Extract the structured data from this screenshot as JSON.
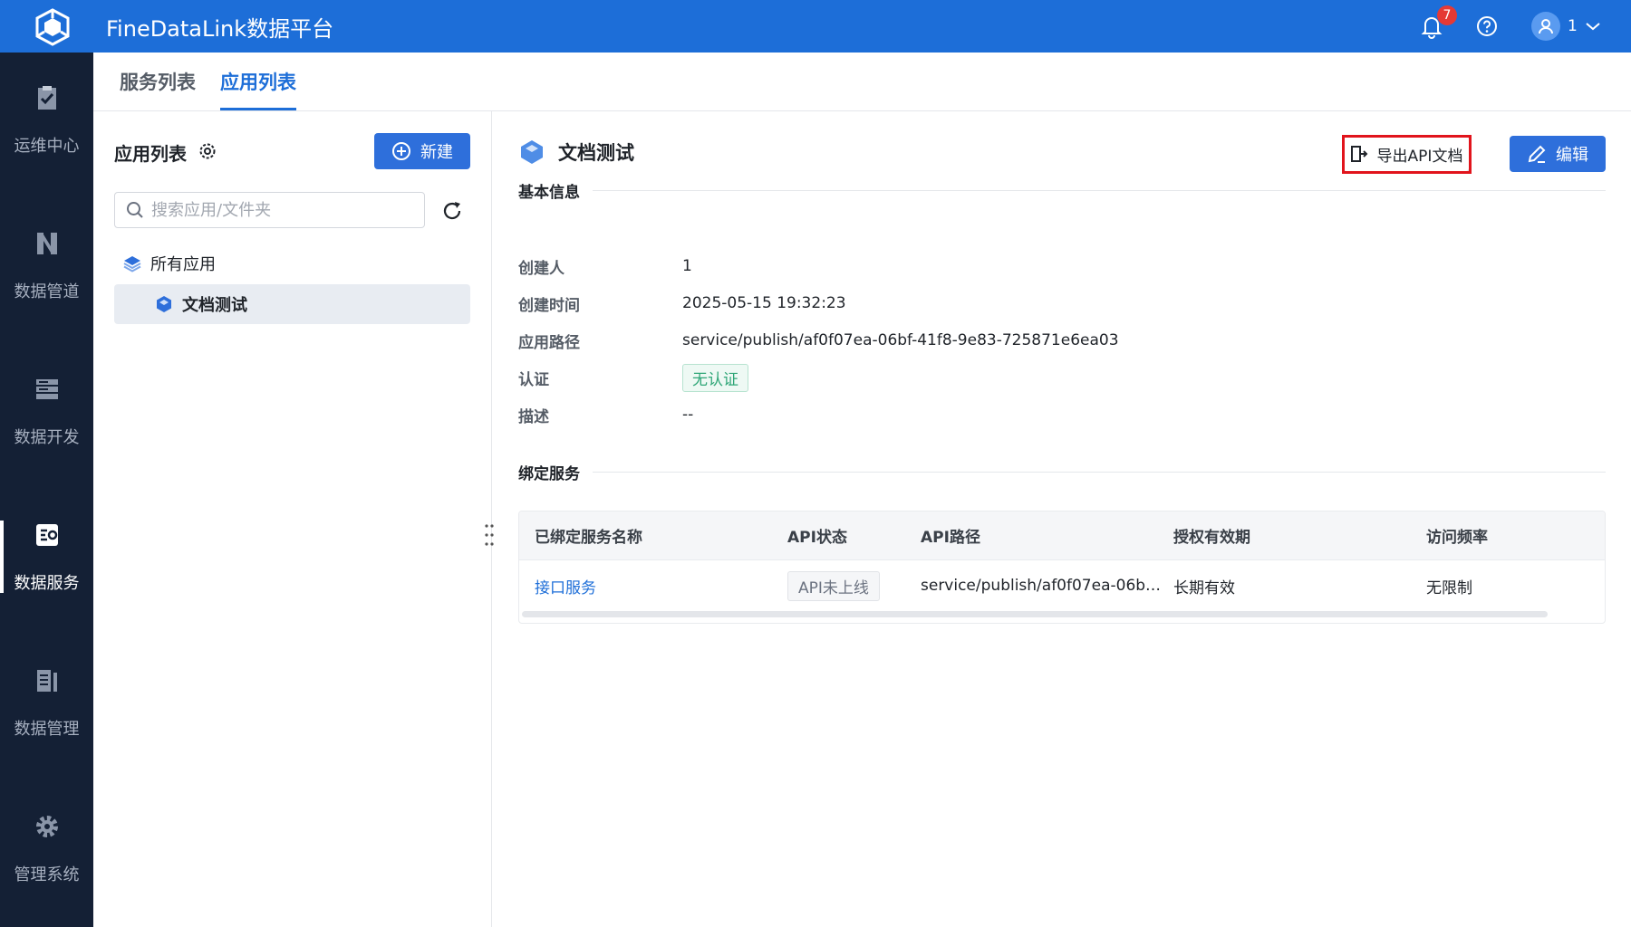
{
  "header": {
    "app_title": "FineDataLink数据平台",
    "notification_count": "7",
    "user_name": "1",
    "brand_color": "#1d6ed8"
  },
  "sidebar": {
    "items": [
      {
        "label": "运维中心",
        "icon": "clipboard-check-icon"
      },
      {
        "label": "数据管道",
        "icon": "pipeline-icon"
      },
      {
        "label": "数据开发",
        "icon": "server-icon"
      },
      {
        "label": "数据服务",
        "icon": "api-service-icon",
        "active": true
      },
      {
        "label": "数据管理",
        "icon": "catalog-icon"
      },
      {
        "label": "管理系统",
        "icon": "gear-icon"
      }
    ]
  },
  "tabs": [
    {
      "label": "服务列表"
    },
    {
      "label": "应用列表",
      "active": true
    }
  ],
  "left_panel": {
    "title": "应用列表",
    "new_button": "新建",
    "search_placeholder": "搜索应用/文件夹",
    "tree_root": "所有应用",
    "tree_child": "文档测试"
  },
  "detail": {
    "app_name": "文档测试",
    "export_button": "导出API文档",
    "edit_button": "编辑",
    "basic_info_title": "基本信息",
    "fields": [
      {
        "label": "创建人",
        "value": "1"
      },
      {
        "label": "创建时间",
        "value": "2025-05-15 19:32:23"
      },
      {
        "label": "应用路径",
        "value": "service/publish/af0f07ea-06bf-41f8-9e83-725871e6ea03"
      },
      {
        "label": "认证",
        "value": "无认证"
      },
      {
        "label": "描述",
        "value": "--"
      }
    ],
    "bound_title": "绑定服务",
    "table": {
      "columns": [
        "已绑定服务名称",
        "API状态",
        "API路径",
        "授权有效期",
        "访问频率"
      ],
      "rows": [
        [
          "接口服务",
          "API未上线",
          "service/publish/af0f07ea-06b…",
          "长期有效",
          "无限制"
        ]
      ]
    }
  }
}
